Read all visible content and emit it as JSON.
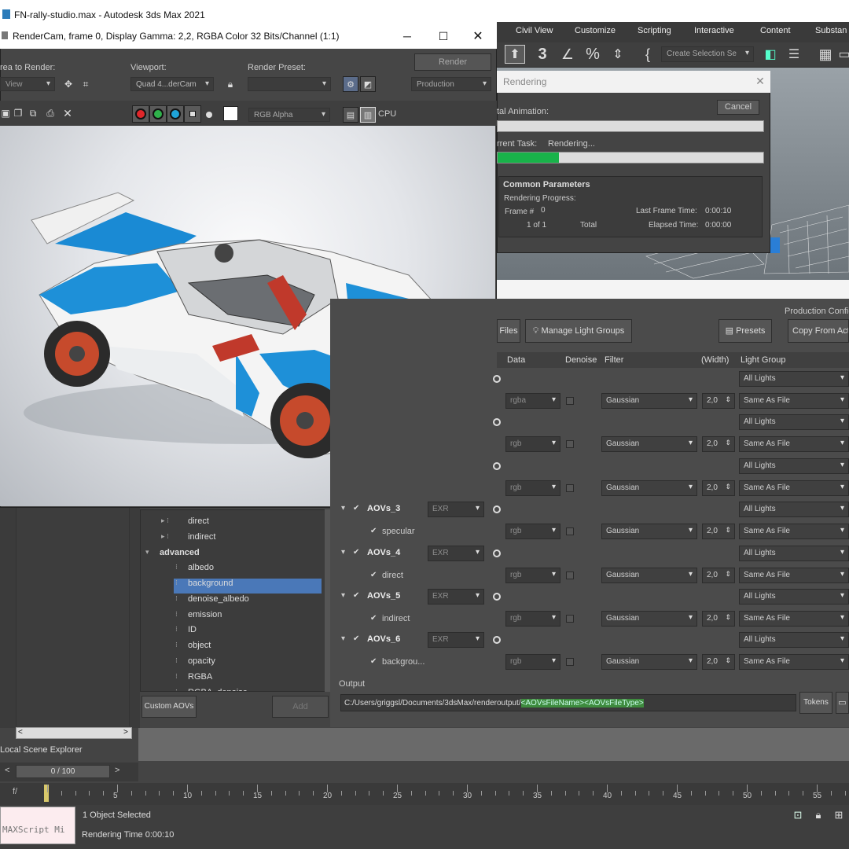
{
  "app": {
    "title": "FN-rally-studio.max - Autodesk 3ds Max 2021",
    "menu": [
      "Civil View",
      "Customize",
      "Scripting",
      "Interactive",
      "Content",
      "Substan"
    ],
    "create_selection_set": "Create Selection Se"
  },
  "frame_window": {
    "title": "RenderCam, frame 0, Display Gamma: 2,2, RGBA Color 32 Bits/Channel (1:1)",
    "area_to_render_label": "rea to Render:",
    "area_to_render_value": "View",
    "viewport_label": "Viewport:",
    "viewport_value": "Quad 4...derCam",
    "render_preset_label": "Render Preset:",
    "render_preset_value": "",
    "render_button": "Render",
    "production_value": "Production",
    "channel_value": "RGB Alpha",
    "cpu_label": "CPU",
    "swatch_colors": [
      "#e0262a",
      "#2fb14b",
      "#1fa3d8"
    ]
  },
  "progress": {
    "title": "Rendering",
    "total_animation_label": "tal Animation:",
    "cancel_button": "Cancel",
    "current_task_label": "rrent Task:",
    "current_task_value": "Rendering...",
    "current_progress": 0.23,
    "section_title": "Common Parameters",
    "rendering_progress_label": "Rendering Progress:",
    "frame_label": "Frame #",
    "frame_value": "0",
    "of_value": "1 of 1",
    "total_label": "Total",
    "last_frame_time_label": "Last Frame Time:",
    "last_frame_time_value": "0:00:10",
    "elapsed_time_label": "Elapsed Time:",
    "elapsed_time_value": "0:00:00"
  },
  "aov_panel": {
    "files_button": "Files",
    "manage_light_groups_button": "Manage Light Groups",
    "presets_button": "Presets",
    "production_config_label": "Production Config",
    "copy_from_active_button": "Copy From Acti",
    "headers": {
      "data": "Data",
      "denoise": "Denoise",
      "filter": "Filter",
      "width": "(Width)",
      "light_group": "Light Group"
    },
    "rows": [
      {
        "name": "AOVs_3",
        "format": "EXR",
        "sub": "specular",
        "data": "rgb",
        "filter": "Gaussian",
        "width": "2,0",
        "group_all": "All Lights",
        "group": "Same As File"
      },
      {
        "name": "AOVs_4",
        "format": "EXR",
        "sub": "direct",
        "data": "rgb",
        "filter": "Gaussian",
        "width": "2,0",
        "group_all": "All Lights",
        "group": "Same As File"
      },
      {
        "name": "AOVs_5",
        "format": "EXR",
        "sub": "indirect",
        "data": "rgb",
        "filter": "Gaussian",
        "width": "2,0",
        "group_all": "All Lights",
        "group": "Same As File"
      },
      {
        "name": "AOVs_6",
        "format": "EXR",
        "sub": "backgrou...",
        "data": "rgb",
        "filter": "Gaussian",
        "width": "2,0",
        "group_all": "All Lights",
        "group": "Same As File"
      }
    ],
    "upper_rows": [
      {
        "data": "rgba",
        "filter": "Gaussian",
        "width": "2,0",
        "group_all": "All Lights",
        "group": "Same As File"
      },
      {
        "data": "rgb",
        "filter": "Gaussian",
        "width": "2,0",
        "group_all": "All Lights",
        "group": "Same As File"
      },
      {
        "data": "rgb",
        "filter": "Gaussian",
        "width": "2,0",
        "group_all": "All Lights",
        "group": "Same As File"
      }
    ],
    "output_label": "Output",
    "output_path": "C:/Users/griggsl/Documents/3dsMax/renderoutput/",
    "output_tokens": "<AOVsFileName><AOVsFileType>",
    "tokens_button": "Tokens"
  },
  "tree": {
    "items": [
      "direct",
      "indirect",
      "advanced",
      "albedo",
      "background",
      "denoise_albedo",
      "emission",
      "ID",
      "object",
      "opacity",
      "RGBA",
      "RGBA_denoise"
    ],
    "custom_aovs_button": "Custom AOVs",
    "add_button": "Add"
  },
  "bottom": {
    "scene_explorer": "Local Scene Explorer",
    "frame_counter": "0 / 100",
    "ticks": [
      "5",
      "10",
      "15",
      "20",
      "25",
      "30",
      "35",
      "40",
      "45",
      "50",
      "55"
    ],
    "maxscript": "MAXScript Mi",
    "selected": "1 Object Selected",
    "rendering_time": "Rendering Time  0:00:10"
  }
}
